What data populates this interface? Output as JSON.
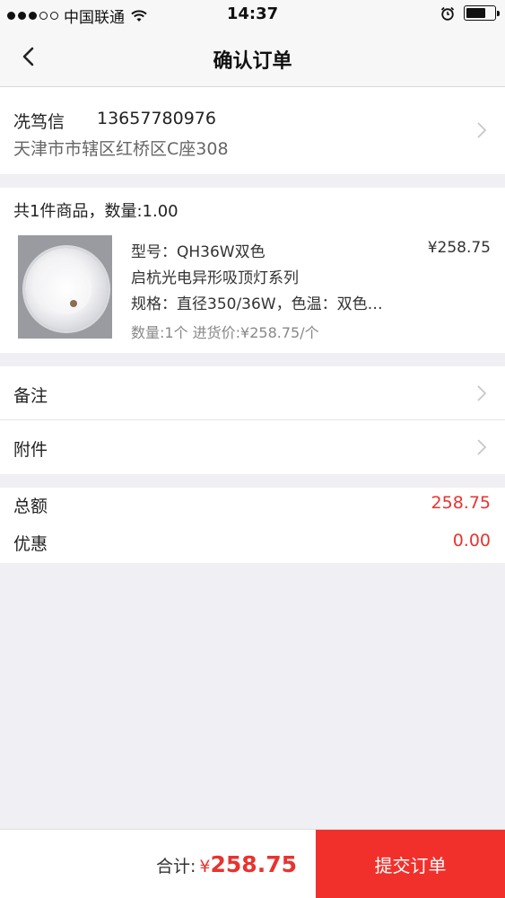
{
  "status_bar": {
    "carrier": "中国联通",
    "time": "14:37",
    "battery_level": 0.7,
    "icons": [
      "signal-dots-icon",
      "wifi-icon",
      "alarm-icon",
      "battery-icon"
    ]
  },
  "nav": {
    "title": "确认订单",
    "back_icon": "chevron-left-icon"
  },
  "address": {
    "name": "冼笃信",
    "phone": "13657780976",
    "line": "天津市市辖区红桥区C座308"
  },
  "goods": {
    "summary": "共1件商品，数量:1.00",
    "items": [
      {
        "model": "型号：QH36W双色",
        "price": "¥258.75",
        "name": "启杭光电异形吸顶灯系列",
        "spec": "规格：直径350/36W，色温：双色…",
        "qty_info": "数量:1个  进货价:¥258.75/个"
      }
    ]
  },
  "options": [
    {
      "label": "备注"
    },
    {
      "label": "附件"
    }
  ],
  "totals": [
    {
      "label": "总额",
      "value": "258.75"
    },
    {
      "label": "优惠",
      "value": "0.00"
    }
  ],
  "footer": {
    "total_label": "合计:",
    "currency": "¥",
    "total_amount": "258.75",
    "submit_label": "提交订单"
  },
  "colors": {
    "accent": "#f2302b",
    "price_red": "#e8332f",
    "background": "#efeff4"
  }
}
